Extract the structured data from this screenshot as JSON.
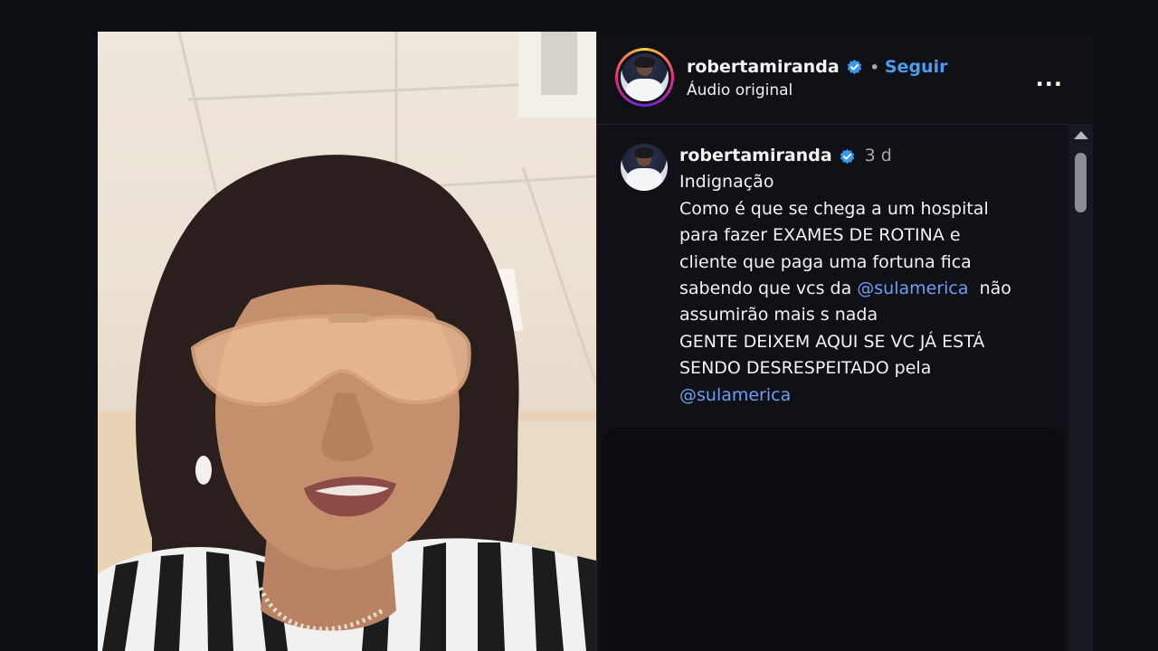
{
  "post": {
    "author": "robertamiranda",
    "follow_label": "Seguir",
    "separator": "•",
    "audio_label": "Áudio original",
    "more_label": "..."
  },
  "caption": {
    "author": "robertamiranda",
    "time": "3 d",
    "lines": [
      "Indignação",
      "Como é que se chega a um hospital",
      "para fazer EXAMES DE ROTINA e",
      "cliente que paga uma fortuna fica",
      "sabendo que vcs da ",
      "@sulamerica",
      "  não",
      "assumirão mais s nada",
      "GENTE DEIXEM AQUI SE VC JÁ ESTÁ",
      "SENDO DESRESPEITADO pela",
      "@sulamerica"
    ]
  },
  "colors": {
    "background": "#0c1015",
    "panel": "#0f1116",
    "link": "#4c9cf0",
    "mention": "#6e9df5",
    "verified": "#3897f0"
  },
  "icons": {
    "verified": "verified-badge-icon",
    "more": "more-options-icon",
    "scroll_up": "scroll-up-arrow-icon"
  }
}
